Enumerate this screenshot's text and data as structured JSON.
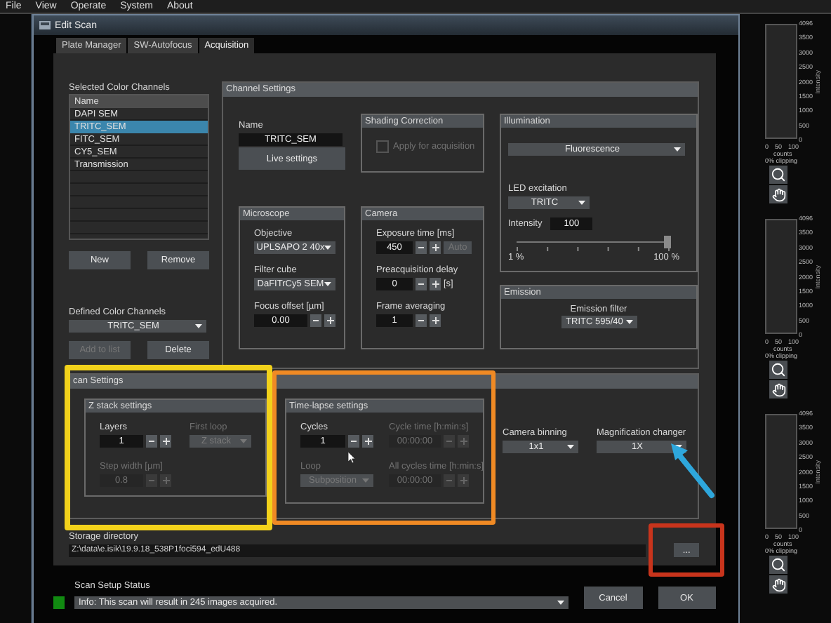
{
  "menu": [
    "File",
    "View",
    "Operate",
    "System",
    "About"
  ],
  "dialog": {
    "title": "Edit Scan",
    "tabs": [
      {
        "label": "Plate Manager",
        "selected": false
      },
      {
        "label": "SW-Autofocus",
        "selected": false
      },
      {
        "label": "Acquisition",
        "selected": true
      }
    ],
    "selected_channels": {
      "label": "Selected Color Channels",
      "column": "Name",
      "rows": [
        {
          "name": "DAPI SEM",
          "selected": false
        },
        {
          "name": "TRITC_SEM",
          "selected": true
        },
        {
          "name": "FITC_SEM",
          "selected": false
        },
        {
          "name": "CY5_SEM",
          "selected": false
        },
        {
          "name": "Transmission",
          "selected": false
        }
      ],
      "buttons": [
        {
          "label": "New",
          "disabled": false
        },
        {
          "label": "Remove",
          "disabled": false
        }
      ]
    },
    "defined_channels": {
      "label": "Defined Color Channels",
      "value": "TRITC_SEM",
      "buttons": [
        {
          "label": "Add to list",
          "disabled": true
        },
        {
          "label": "Delete",
          "disabled": false
        }
      ]
    },
    "channel_settings": {
      "title": "Channel Settings",
      "name_label": "Name",
      "name_value": "TRITC_SEM",
      "live_button": "Live settings",
      "shading": {
        "title": "Shading Correction",
        "checkbox": {
          "label": "Apply for acquisition",
          "checked": false,
          "disabled": true
        }
      },
      "illumination": {
        "title": "Illumination",
        "mode": "Fluorescence",
        "led_label": "LED excitation",
        "led": "TRITC",
        "intensity_label": "Intensity",
        "intensity": "100",
        "level": 1,
        "min": "1 %",
        "max": "100 %"
      },
      "microscope": {
        "title": "Microscope",
        "fields": [
          {
            "kind": "select",
            "label": "Objective",
            "value": "UPLSAPO 2 40x",
            "disabled": false
          },
          {
            "kind": "select",
            "label": "Filter cube",
            "value": "DaFITrCy5 SEM",
            "disabled": false
          },
          {
            "kind": "spin",
            "label": "Focus offset [µm]",
            "value": "0.00",
            "disabled": false
          }
        ]
      },
      "camera": {
        "title": "Camera",
        "fields": [
          {
            "kind": "spin",
            "label": "Exposure time [ms]",
            "value": "450",
            "disabled": false,
            "extra": {
              "label": "Auto",
              "disabled": true
            }
          },
          {
            "kind": "spin",
            "label": "Preacquisition delay",
            "value": "0",
            "disabled": false,
            "unit": "[s]"
          },
          {
            "kind": "spin",
            "label": "Frame averaging",
            "value": "1",
            "disabled": false
          }
        ]
      },
      "emission": {
        "title": "Emission",
        "label": "Emission filter",
        "value": "TRITC 595/40"
      }
    },
    "scan_settings": {
      "title": "can Settings",
      "z_stack": {
        "title": "Z stack settings",
        "fields": [
          {
            "kind": "spin",
            "label": "Layers",
            "value": "1",
            "disabled": false
          },
          {
            "kind": "select",
            "label": "First loop",
            "value": "Z stack",
            "disabled": true
          },
          {
            "kind": "spin",
            "label": "Step width [µm]",
            "value": "0.8",
            "disabled": true
          }
        ]
      },
      "time_lapse": {
        "title": "Time-lapse settings",
        "fields": [
          {
            "kind": "spin",
            "label": "Cycles",
            "value": "1",
            "disabled": false
          },
          {
            "kind": "spin",
            "label": "Cycle time [h:min:s]",
            "value": "00:00:00",
            "disabled": true
          },
          {
            "kind": "select",
            "label": "Loop",
            "value": "Subposition",
            "disabled": true
          },
          {
            "kind": "spin",
            "label": "All cycles time [h:min:s]",
            "value": "00:00:00",
            "disabled": true
          }
        ]
      },
      "binning": {
        "label": "Camera binning",
        "value": "1x1"
      },
      "magnification": {
        "label": "Magnification changer",
        "value": "1X"
      }
    },
    "storage": {
      "label": "Storage directory",
      "value": "Z:\\data\\e.isik\\19.9.18_538P1foci594_edU488",
      "browse": "..."
    },
    "status": {
      "label": "Scan Setup Status",
      "color": "#118a11",
      "message": "Info: This scan will result in 245 images acquired."
    },
    "buttons": [
      "Cancel",
      "OK"
    ]
  },
  "histograms": [
    {
      "yticks": [
        "4096",
        "3500",
        "3000",
        "2500",
        "2000",
        "1500",
        "1000",
        "500",
        "0"
      ],
      "ylabel": "Intensity",
      "xticks": [
        "0",
        "50",
        "100"
      ],
      "xlabel": "counts",
      "clipping": "0% clipping"
    },
    {
      "yticks": [
        "4096",
        "3500",
        "3000",
        "2500",
        "2000",
        "1500",
        "1000",
        "500",
        "0"
      ],
      "ylabel": "Intensity",
      "xticks": [
        "0",
        "50",
        "100"
      ],
      "xlabel": "counts",
      "clipping": "0% clipping"
    },
    {
      "yticks": [
        "4096",
        "3500",
        "3000",
        "2500",
        "2000",
        "1500",
        "1000",
        "500",
        "0"
      ],
      "ylabel": "Intensity",
      "xticks": [
        "0",
        "50",
        "100"
      ],
      "xlabel": "counts",
      "clipping": "0% clipping"
    }
  ],
  "annotations": [
    {
      "kind": "box",
      "color": "#f2d21b"
    },
    {
      "kind": "box",
      "color": "#f08a24"
    },
    {
      "kind": "box",
      "color": "#c8341c"
    },
    {
      "kind": "arrow",
      "color": "#2ea7dc"
    }
  ]
}
